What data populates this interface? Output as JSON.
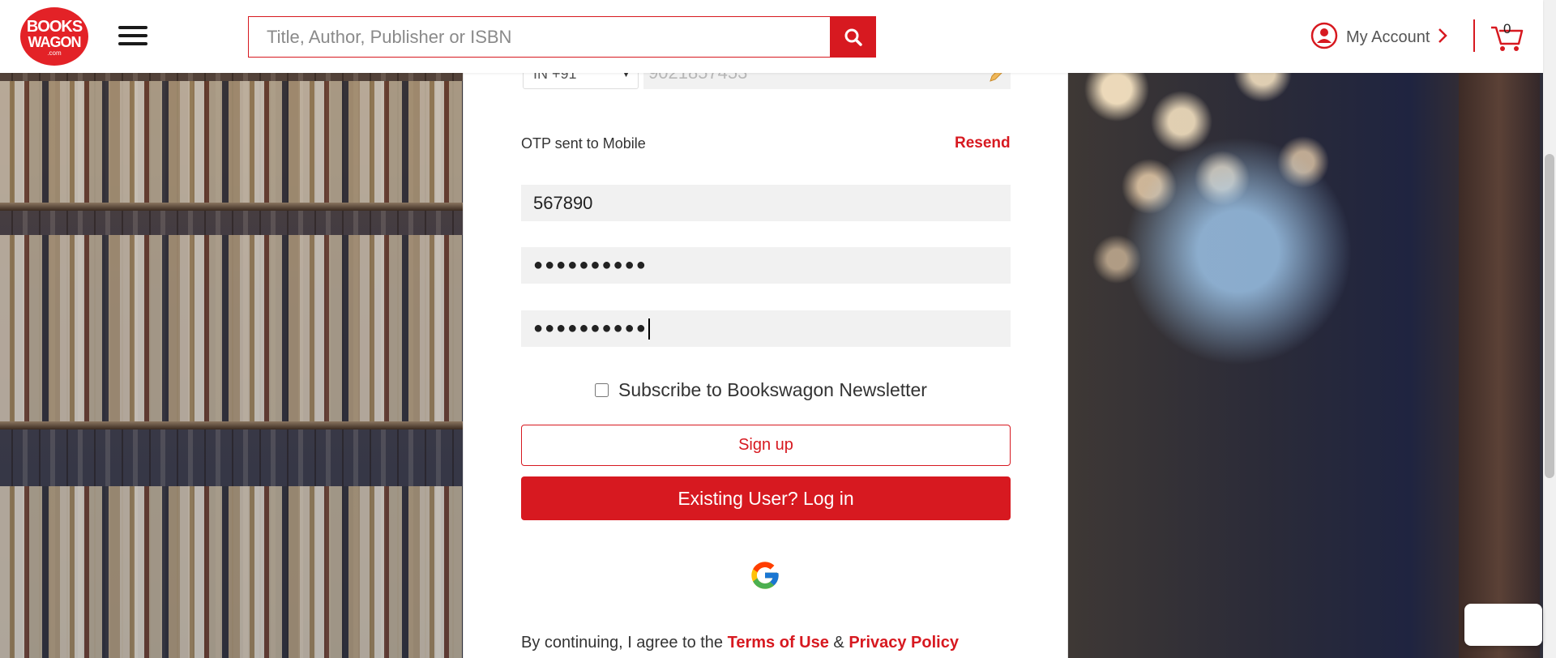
{
  "header": {
    "logo": {
      "line1": "BOOKS",
      "line2": "WAGON",
      "line3": ".com"
    },
    "search": {
      "placeholder": "Title, Author, Publisher or ISBN",
      "value": ""
    },
    "account_label": "My Account",
    "cart_count": "0"
  },
  "form": {
    "country_code": "IN +91",
    "mobile": "9021857453",
    "otp_label": "OTP sent to Mobile",
    "resend_label": "Resend",
    "otp_value": "567890",
    "password_masked": "●●●●●●●●●●",
    "confirm_password_masked": "●●●●●●●●●●",
    "subscribe_label": "Subscribe to Bookswagon Newsletter",
    "subscribe_checked": false,
    "signup_label": "Sign up",
    "login_label": "Existing User? Log in",
    "terms_prefix": "By continuing, I agree to the",
    "terms_link": "Terms of Use",
    "terms_amp": "&",
    "privacy_link": "Privacy Policy"
  },
  "colors": {
    "brand_red": "#d71920",
    "field_bg": "#f1f1f1"
  },
  "icons": [
    "menu-icon",
    "search-icon",
    "user-circle-icon",
    "chevron-right-icon",
    "cart-icon",
    "edit-pencil-icon",
    "google-icon"
  ]
}
